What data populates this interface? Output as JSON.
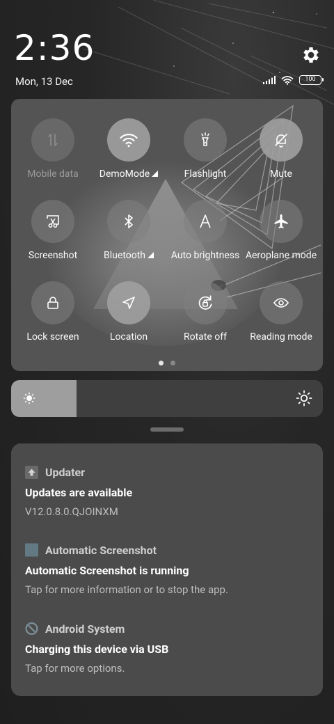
{
  "status": {
    "time": "2:36",
    "date": "Mon, 13 Dec",
    "battery": "100"
  },
  "quick_settings": {
    "tiles": [
      {
        "label": "Mobile data",
        "icon": "mobile-data-icon",
        "active": false,
        "disabled": true
      },
      {
        "label": "DemoMode",
        "icon": "wifi-icon",
        "active": true,
        "disabled": false
      },
      {
        "label": "Flashlight",
        "icon": "flashlight-icon",
        "active": false,
        "disabled": false
      },
      {
        "label": "Mute",
        "icon": "bell-off-icon",
        "active": true,
        "disabled": false
      },
      {
        "label": "Screenshot",
        "icon": "screenshot-icon",
        "active": false,
        "disabled": false
      },
      {
        "label": "Bluetooth",
        "icon": "bluetooth-icon",
        "active": false,
        "disabled": false
      },
      {
        "label": "Auto brightness",
        "icon": "auto-brightness-icon",
        "active": false,
        "disabled": false
      },
      {
        "label": "Aeroplane mode",
        "icon": "airplane-icon",
        "active": false,
        "disabled": false
      },
      {
        "label": "Lock screen",
        "icon": "lock-icon",
        "active": false,
        "disabled": false
      },
      {
        "label": "Location",
        "icon": "location-icon",
        "active": true,
        "disabled": false
      },
      {
        "label": "Rotate off",
        "icon": "rotate-lock-icon",
        "active": false,
        "disabled": false
      },
      {
        "label": "Reading mode",
        "icon": "eye-icon",
        "active": false,
        "disabled": false
      }
    ],
    "page_count": 2,
    "current_page": 1
  },
  "brightness": {
    "level": 0.21
  },
  "notifications": [
    {
      "app": "Updater",
      "title": "Updates are available",
      "body": "V12.0.8.0.QJOINXM",
      "icon": "updater-icon"
    },
    {
      "app": "Automatic Screenshot",
      "title": "Automatic Screenshot is running",
      "body": "Tap for more information or to stop the app.",
      "icon": "auto-screenshot-app-icon"
    },
    {
      "app": "Android System",
      "title": "Charging this device via USB",
      "body": "Tap for more options.",
      "icon": "android-system-icon"
    }
  ],
  "colors": {
    "tile_active": "#9e9e9e",
    "tile_inactive": "#808080",
    "panel": "#545454",
    "notification_panel": "#4b4b4b"
  }
}
